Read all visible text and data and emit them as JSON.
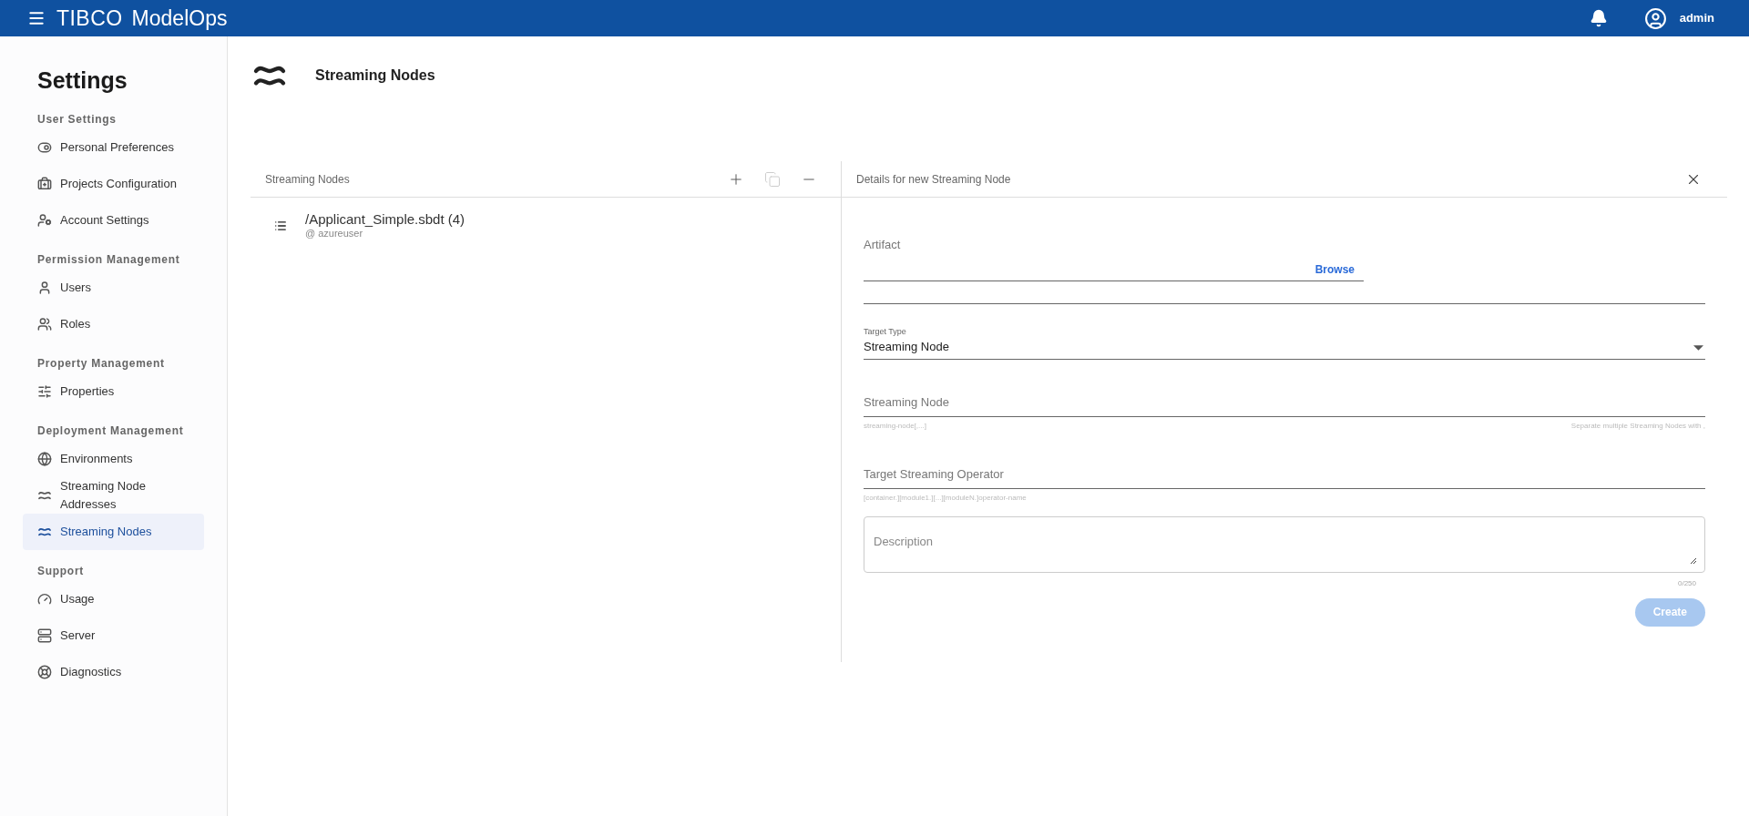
{
  "top_bar": {
    "brand": "TIBCO",
    "product": "ModelOps",
    "user": "admin"
  },
  "sidebar": {
    "title": "Settings",
    "sections": [
      {
        "heading": "User Settings",
        "items": [
          {
            "label": "Personal Preferences",
            "selected": false
          },
          {
            "label": "Projects Configuration",
            "selected": false
          },
          {
            "label": "Account Settings",
            "selected": false
          }
        ]
      },
      {
        "heading": "Permission Management",
        "items": [
          {
            "label": "Users",
            "selected": false
          },
          {
            "label": "Roles",
            "selected": false
          }
        ]
      },
      {
        "heading": "Property Management",
        "items": [
          {
            "label": "Properties",
            "selected": false
          }
        ]
      },
      {
        "heading": "Deployment Management",
        "items": [
          {
            "label": "Environments",
            "selected": false
          },
          {
            "label": "Streaming Node Addresses",
            "selected": false
          },
          {
            "label": "Streaming Nodes",
            "selected": true
          }
        ]
      },
      {
        "heading": "Support",
        "items": [
          {
            "label": "Usage",
            "selected": false
          },
          {
            "label": "Server",
            "selected": false
          },
          {
            "label": "Diagnostics",
            "selected": false
          }
        ]
      }
    ]
  },
  "page": {
    "title": "Streaming Nodes"
  },
  "list_pane": {
    "title": "Streaming Nodes",
    "toolbar": [
      {
        "disabled": false
      },
      {
        "disabled": true
      },
      {
        "disabled": false
      }
    ],
    "items": [
      {
        "name": "/Applicant_Simple.sbdt (4)",
        "owner": "@ azureuser"
      }
    ]
  },
  "details_pane": {
    "title": "Details for new Streaming Node",
    "fields": [
      {
        "kind": "browse",
        "label": "Artifact",
        "action": "Browse"
      },
      {
        "kind": "select",
        "label": "Target Type",
        "value": "Streaming Node"
      },
      {
        "kind": "text",
        "label": "Streaming Node",
        "hint": "streaming-node[,...]",
        "hint_right": "Separate multiple Streaming Nodes with ,"
      },
      {
        "kind": "text",
        "label": "Target Streaming Operator",
        "hint": "[container.][module1.][...][moduleN.]operator-name"
      },
      {
        "kind": "textarea",
        "placeholder": "Description",
        "counter": "0/250"
      }
    ],
    "submit": {
      "label": "Create",
      "disabled": true
    }
  }
}
